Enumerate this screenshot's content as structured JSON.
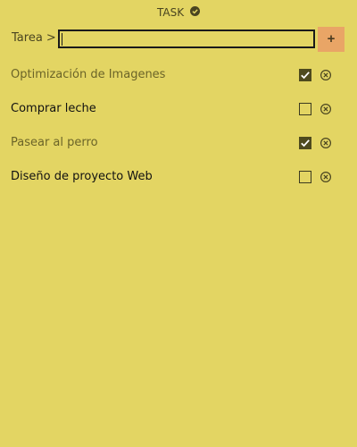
{
  "header": {
    "title": "TASK",
    "icon": "check-circle-icon"
  },
  "input": {
    "label": "Tarea >",
    "value": "",
    "placeholder": ""
  },
  "add_button": {
    "label": "+",
    "color": "#e9a566"
  },
  "tasks": [
    {
      "text": "Optimización de Imagenes",
      "completed": true
    },
    {
      "text": "Comprar leche",
      "completed": false
    },
    {
      "text": "Pasear al perro",
      "completed": true
    },
    {
      "text": "Diseño de proyecto Web",
      "completed": false
    }
  ],
  "colors": {
    "background": "#e3d563",
    "completed_text": "#6b6428",
    "pending_text": "#111111"
  }
}
